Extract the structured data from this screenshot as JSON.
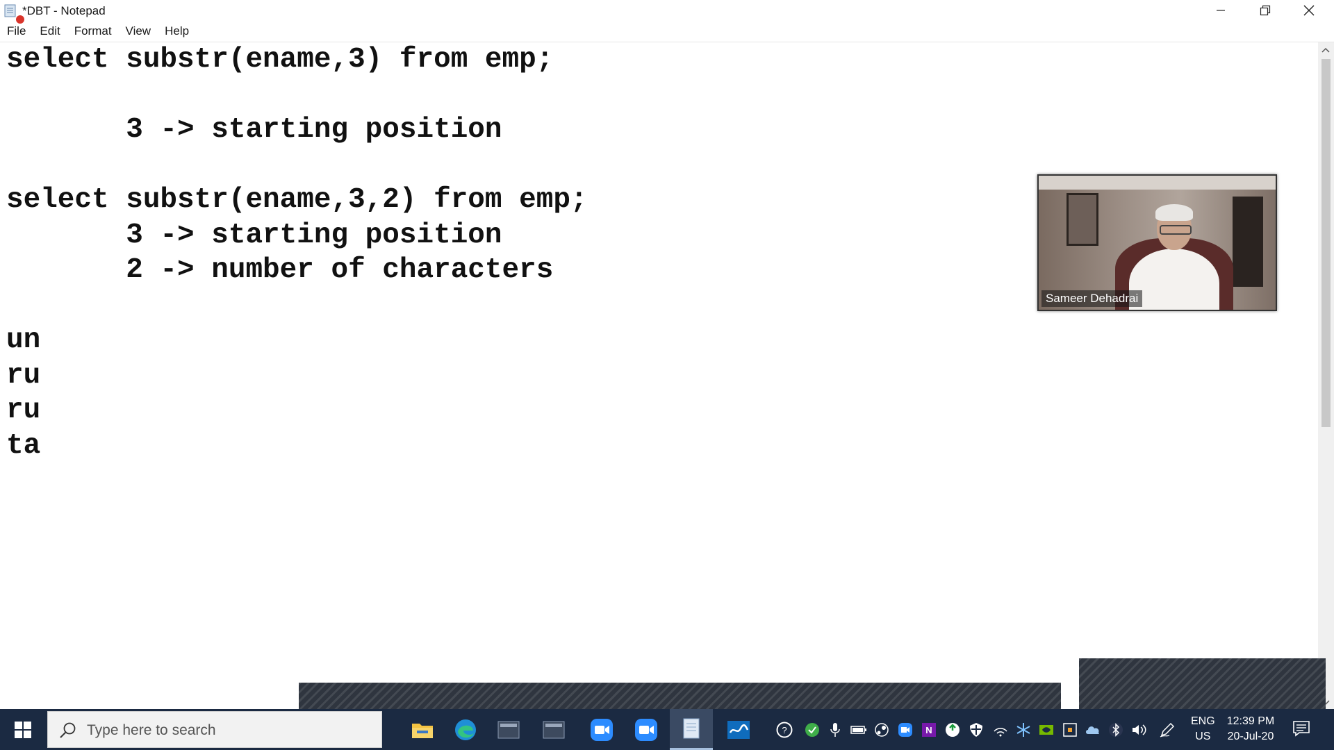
{
  "window": {
    "title": "*DBT - Notepad"
  },
  "menu": {
    "items": [
      "File",
      "Edit",
      "Format",
      "View",
      "Help"
    ]
  },
  "editor": {
    "content": "select substr(ename,3) from emp;\n\n       3 -> starting position\n\nselect substr(ename,3,2) from emp;\n       3 -> starting position\n       2 -> number of characters\n\nun\nru\nru\nta"
  },
  "video": {
    "participant_name": "Sameer Dehadrai"
  },
  "taskbar": {
    "search_placeholder": "Type here to search",
    "language_top": "ENG",
    "language_bottom": "US",
    "time": "12:39 PM",
    "date": "20-Jul-20"
  },
  "icons": {
    "app": "notepad-icon",
    "minimize": "minimize-icon",
    "restore": "restore-icon",
    "close": "close-icon",
    "start": "windows-start-icon",
    "search": "search-icon",
    "taskbar_apps": [
      "file-explorer-icon",
      "edge-icon",
      "sql-app-icon",
      "sql-app-icon",
      "zoom-icon",
      "zoom-meeting-icon",
      "notepad-icon",
      "whiteboard-icon"
    ],
    "tray": [
      "help-icon",
      "security-check-icon",
      "microphone-icon",
      "battery-icon",
      "steam-icon",
      "zoom-tray-icon",
      "onenote-icon",
      "update-icon",
      "shield-icon",
      "wifi-icon",
      "snowflake-icon",
      "nvidia-icon",
      "app-tray-icon",
      "cloud-icon",
      "bluetooth-icon",
      "volume-icon",
      "pen-icon"
    ],
    "notifications": "notifications-icon"
  }
}
